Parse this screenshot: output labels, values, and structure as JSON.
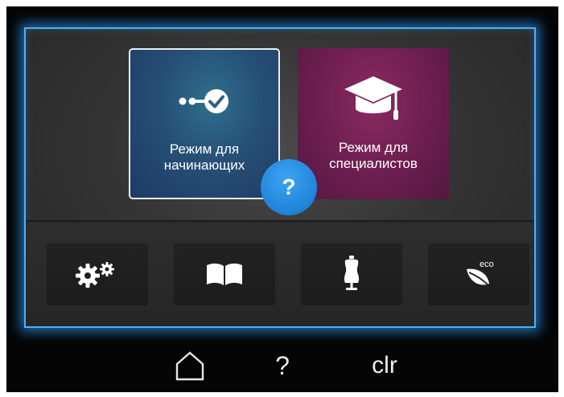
{
  "modes": {
    "beginner": {
      "label_line1": "Режим для",
      "label_line2": "начинающих",
      "icon": "progress-check-icon"
    },
    "expert": {
      "label_line1": "Режим для",
      "label_line2": "специалистов",
      "icon": "graduation-cap-icon"
    },
    "help_badge": "?"
  },
  "tools": [
    {
      "icon": "settings-gears-icon"
    },
    {
      "icon": "open-book-icon"
    },
    {
      "icon": "dress-form-icon"
    },
    {
      "icon": "eco-leaf-icon",
      "text": "eco"
    }
  ],
  "nav": {
    "home_icon": "home-icon",
    "help_label": "?",
    "clear_label": "clr"
  },
  "colors": {
    "glow": "#4fb0f5",
    "beginner_tile": "#264f76",
    "expert_tile": "#6c1e4e",
    "help_badge": "#1f83d8"
  }
}
